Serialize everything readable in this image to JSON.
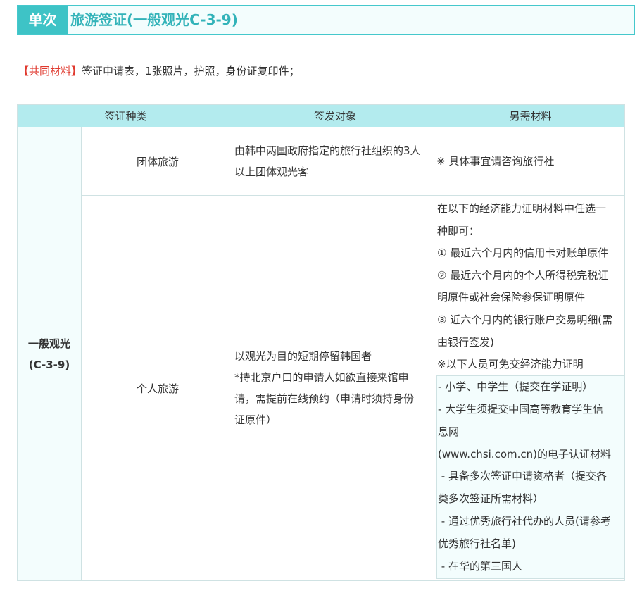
{
  "header": {
    "tag": "单次",
    "title": "旅游签证(一般观光C-3-9)"
  },
  "common_materials": {
    "label": "【共同材料】",
    "text": "签证申请表，1张照片，护照，身份证复印件；"
  },
  "table": {
    "headers": [
      "签证种类",
      "签发对象",
      "另需材料"
    ],
    "visa_type_lines": [
      "一般观光",
      "(C-3-9)"
    ],
    "rows": [
      {
        "subtype": "团体旅游",
        "target_lines": [
          "由韩中两国政府指定的旅行社组织的3人",
          "以上团体观光客"
        ],
        "materials_lines": [
          "※ 具体事宜请咨询旅行社"
        ]
      },
      {
        "subtype": "个人旅游",
        "target_lines": [
          "以观光为目的短期停留韩国者",
          "*持北京户口的申请人如欲直接来馆申",
          "请，需提前在线预约（申请时须持身份",
          "证原件）"
        ],
        "materials_lines": [
          "在以下的经济能力证明材料中任选一",
          "种即可：",
          "① 最近六个月内的信用卡对账单原件",
          "② 最近六个月内的个人所得税完税证",
          "明原件或社会保险参保证明原件",
          "③ 近六个月内的银行账户交易明细(需",
          "由银行签发)",
          "※以下人员可免交经济能力证明"
        ],
        "exempt_lines": [
          "- 小学、中学生（提交在学证明）",
          "- 大学生须提交中国高等教育学生信",
          "息网",
          "(www.chsi.com.cn)的电子认证材料",
          " - 具备多次签证申请资格者（提交各",
          "类多次签证所需材料）",
          " - 通过优秀旅行社代办的人员(请参考",
          "优秀旅行社名单)",
          " - 在华的第三国人"
        ]
      }
    ]
  }
}
